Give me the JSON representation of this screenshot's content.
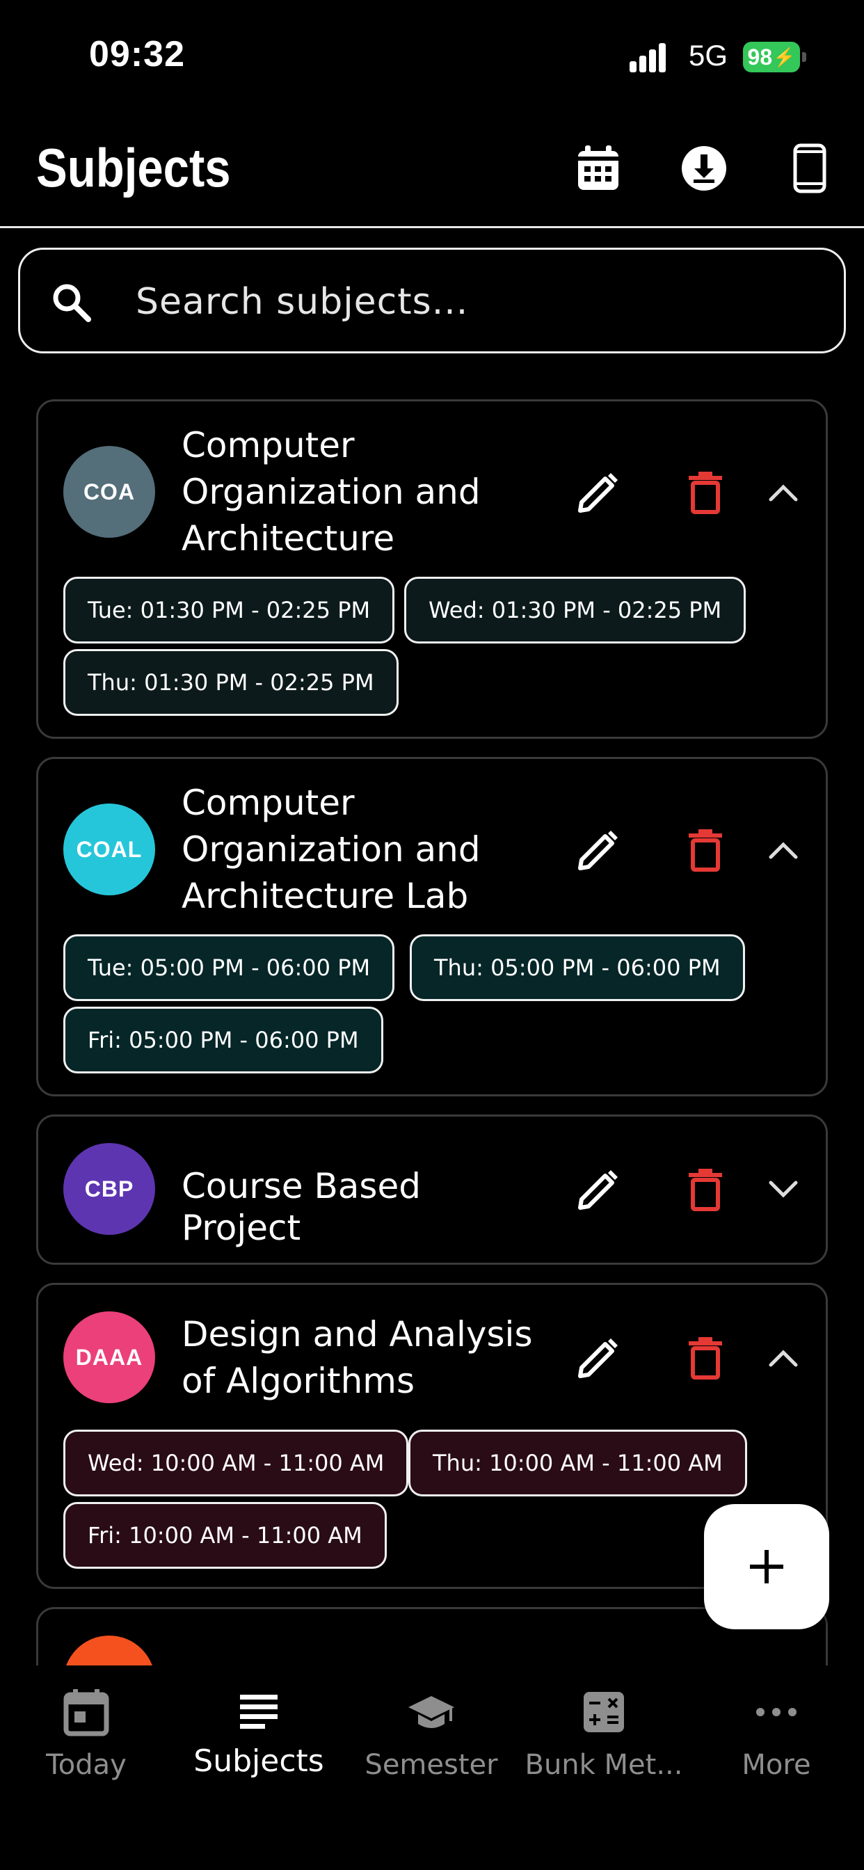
{
  "status_bar": {
    "time": "09:32",
    "network": "5G",
    "battery": "98"
  },
  "header": {
    "title": "Subjects",
    "icons": [
      "calendar-icon",
      "download-icon",
      "phone-icon"
    ]
  },
  "search": {
    "placeholder": "Search subjects..."
  },
  "subjects": [
    {
      "abbr": "COA",
      "name": "Computer Organization and Architecture",
      "color": "#546e7a",
      "chip_bg": "#0d1a1c",
      "expanded": true,
      "schedule": [
        "Tue: 01:30 PM - 02:25 PM",
        "Wed: 01:30 PM - 02:25 PM",
        "Thu: 01:30 PM - 02:25 PM"
      ]
    },
    {
      "abbr": "COAL",
      "name": "Computer Organization and Architecture Lab",
      "color": "#26c6da",
      "chip_bg": "#062628",
      "expanded": true,
      "schedule": [
        "Tue: 05:00 PM - 06:00 PM",
        "Thu: 05:00 PM - 06:00 PM",
        "Fri: 05:00 PM - 06:00 PM"
      ]
    },
    {
      "abbr": "CBP",
      "name": "Course Based Project",
      "color": "#5e35b1",
      "chip_bg": "#120c24",
      "expanded": false,
      "schedule": []
    },
    {
      "abbr": "DAAA",
      "name": "Design and Analysis of Algorithms",
      "color": "#ec407a",
      "chip_bg": "#2a0c16",
      "expanded": true,
      "schedule": [
        "Wed: 10:00 AM - 11:00 AM",
        "Thu: 10:00 AM - 11:00 AM",
        "Fri: 10:00 AM - 11:00 AM"
      ]
    }
  ],
  "partial_card_color": "#f4511e",
  "colors": {
    "delete": "#e53935",
    "accent_text": "#ffffff",
    "inactive_nav": "#8e8e8e"
  },
  "fab": {
    "label": "+"
  },
  "nav": [
    {
      "label": "Today",
      "icon": "calendar-today-icon",
      "active": false
    },
    {
      "label": "Subjects",
      "icon": "list-icon",
      "active": true
    },
    {
      "label": "Semester",
      "icon": "graduation-cap-icon",
      "active": false
    },
    {
      "label": "Bunk Met...",
      "icon": "calculator-icon",
      "active": false
    },
    {
      "label": "More",
      "icon": "more-dots-icon",
      "active": false
    }
  ]
}
